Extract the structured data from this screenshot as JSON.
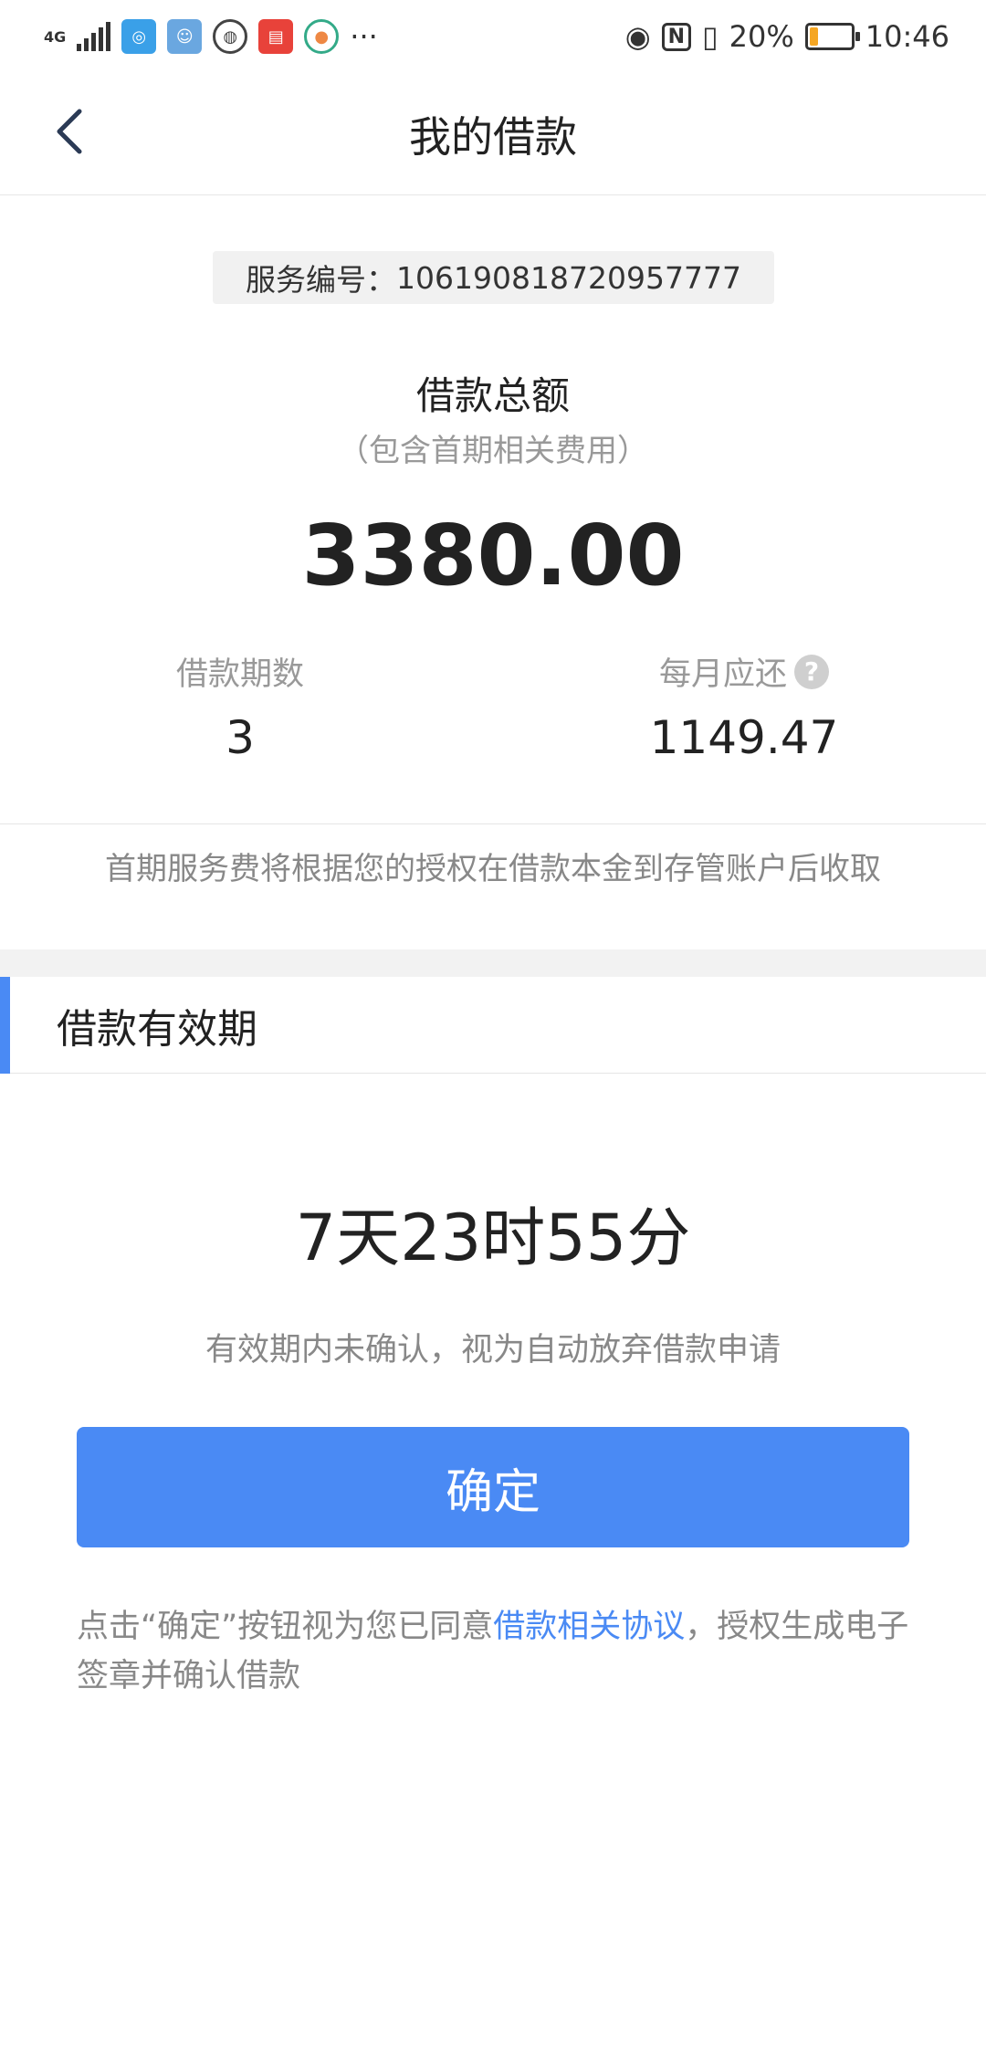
{
  "status_bar": {
    "network": "4G",
    "battery_percent": "20%",
    "battery_level": 0.2,
    "time": "10:46",
    "more": "···",
    "app_icons": [
      "browser-icon",
      "game-icon",
      "globe-icon",
      "toutiao-icon",
      "video-icon"
    ]
  },
  "header": {
    "title": "我的借款"
  },
  "service": {
    "label": "服务编号：",
    "number": "106190818720957777"
  },
  "loan": {
    "total_label": "借款总额",
    "total_sub": "（包含首期相关费用）",
    "total_amount": "3380.00",
    "periods_label": "借款期数",
    "periods_value": "3",
    "monthly_label": "每月应还",
    "monthly_value": "1149.47",
    "fee_note": "首期服务费将根据您的授权在借款本金到存管账户后收取"
  },
  "validity": {
    "section_title": "借款有效期",
    "countdown": "7天23时55分",
    "note": "有效期内未确认，视为自动放弃借款申请"
  },
  "confirm": {
    "button_label": "确定"
  },
  "agreement": {
    "prefix": "点击“确定”按钮视为您已同意",
    "link": "借款相关协议",
    "suffix": "，授权生成电子签章并确认借款"
  },
  "colors": {
    "accent": "#4a8af4",
    "muted_text": "#888888"
  }
}
